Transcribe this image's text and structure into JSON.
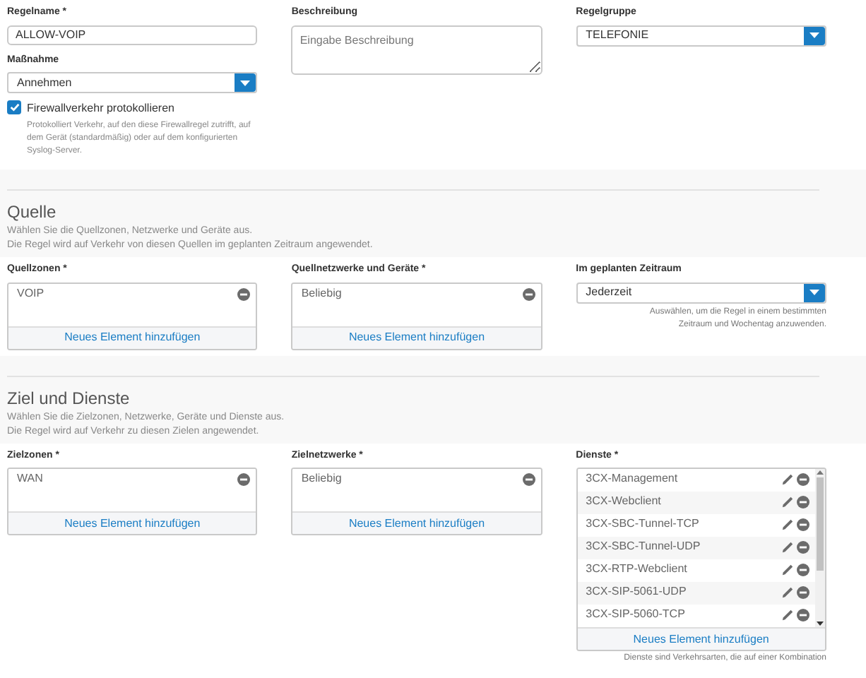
{
  "general": {
    "rule_name": {
      "label": "Regelname *",
      "value": "ALLOW-VOIP"
    },
    "description": {
      "label": "Beschreibung",
      "placeholder": "Eingabe Beschreibung"
    },
    "rule_group": {
      "label": "Regelgruppe",
      "value": "TELEFONIE"
    },
    "action": {
      "label": "Maßnahme",
      "value": "Annehmen"
    },
    "log": {
      "label": "Firewallverkehr protokollieren",
      "checked": true,
      "hint": "Protokolliert Verkehr, auf den diese Firewallregel zutrifft, auf dem Gerät (standardmäßig) oder auf dem konfigurierten Syslog-Server."
    }
  },
  "sections": [
    {
      "title": "Quelle",
      "lines": [
        "Wählen Sie die Quellzonen, Netzwerke und Geräte aus.",
        "Die Regel wird auf Verkehr von diesen Quellen im geplanten Zeitraum angewendet."
      ],
      "fields": [
        {
          "kind": "list",
          "label": "Quellzonen *",
          "items": [
            {
              "name": "VOIP",
              "editable": false
            }
          ],
          "add": "Neues Element hinzufügen"
        },
        {
          "kind": "list",
          "label": "Quellnetzwerke und Geräte *",
          "items": [
            {
              "name": "Beliebig",
              "editable": false
            }
          ],
          "add": "Neues Element hinzufügen"
        },
        {
          "kind": "select",
          "label": "Im geplanten Zeitraum",
          "value": "Jederzeit",
          "hint": "Auswählen, um die Regel in einem bestimmten Zeitraum und Wochentag anzuwenden."
        }
      ]
    },
    {
      "title": "Ziel und Dienste",
      "lines": [
        "Wählen Sie die Zielzonen, Netzwerke, Geräte und Dienste aus.",
        "Die Regel wird auf Verkehr zu diesen Zielen angewendet."
      ],
      "fields": [
        {
          "kind": "list",
          "label": "Zielzonen *",
          "items": [
            {
              "name": "WAN",
              "editable": false
            }
          ],
          "add": "Neues Element hinzufügen"
        },
        {
          "kind": "list",
          "label": "Zielnetzwerke *",
          "items": [
            {
              "name": "Beliebig",
              "editable": false
            }
          ],
          "add": "Neues Element hinzufügen"
        },
        {
          "kind": "scroll-list",
          "label": "Dienste *",
          "items": [
            {
              "name": "3CX-Management",
              "editable": true
            },
            {
              "name": "3CX-Webclient",
              "editable": true
            },
            {
              "name": "3CX-SBC-Tunnel-TCP",
              "editable": true
            },
            {
              "name": "3CX-SBC-Tunnel-UDP",
              "editable": true
            },
            {
              "name": "3CX-RTP-Webclient",
              "editable": true
            },
            {
              "name": "3CX-SIP-5061-UDP",
              "editable": true
            },
            {
              "name": "3CX-SIP-5060-TCP",
              "editable": true
            }
          ],
          "add": "Neues Element hinzufügen",
          "hint": "Dienste sind Verkehrsarten, die auf einer Kombination"
        }
      ]
    }
  ]
}
